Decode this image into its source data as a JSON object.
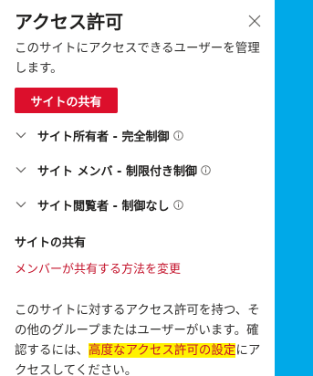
{
  "panel": {
    "title": "アクセス許可",
    "description": "このサイトにアクセスできるユーザーを管理します。",
    "share_button_label": "サイトの共有",
    "groups": [
      {
        "label": "サイト所有者 - 完全制御",
        "icon": "chevron-down-icon",
        "info_icon": "info-icon"
      },
      {
        "label": "サイト メンバ - 制限付き制御",
        "icon": "chevron-down-icon",
        "info_icon": "info-icon"
      },
      {
        "label": "サイト閲覧者 - 制御なし",
        "icon": "chevron-down-icon",
        "info_icon": "info-icon"
      }
    ],
    "sharing": {
      "title": "サイトの共有",
      "link_label": "メンバーが共有する方法を変更"
    },
    "advanced": {
      "text_before": "このサイトに対するアクセス許可を持つ、その他のグループまたはユーザーがいます。確認するには、",
      "link_label": "高度なアクセス許可の設定",
      "text_after": "にアクセスしてください。"
    }
  },
  "colors": {
    "accent_red": "#dc0f2c",
    "link_red": "#c4142c",
    "highlight_yellow": "#fff200",
    "side_strip_blue": "#00a9e8"
  }
}
